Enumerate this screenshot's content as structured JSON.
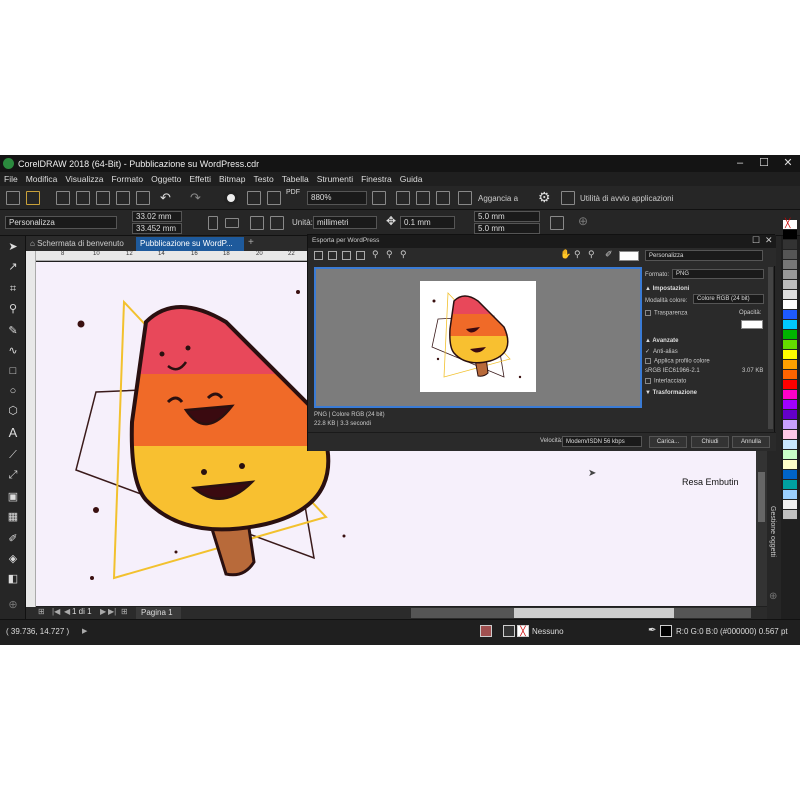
{
  "window": {
    "title": "CorelDRAW 2018 (64-Bit) - Pubblicazione su WordPress.cdr"
  },
  "menu": [
    "File",
    "Modifica",
    "Visualizza",
    "Formato",
    "Oggetto",
    "Effetti",
    "Bitmap",
    "Testo",
    "Tabella",
    "Strumenti",
    "Finestra",
    "Guida"
  ],
  "toolbar": {
    "zoom": "880%",
    "snap_label": "Aggancia a",
    "launch_label": "Utilità di avvio applicazioni"
  },
  "propbar": {
    "preset": "Personalizza",
    "width": "33.02 mm",
    "height": "33.452 mm",
    "unit_label": "Unità:",
    "unit_value": "millimetri",
    "nudge": "0.1 mm",
    "dup_x": "5.0 mm",
    "dup_y": "5.0 mm"
  },
  "tabs": {
    "welcome": "Schermata di benvenuto",
    "doc": "Pubblicazione su WordP..."
  },
  "ruler": [
    "8",
    "10",
    "12",
    "14",
    "16",
    "18",
    "20",
    "22",
    "24",
    "26",
    "28",
    "30",
    "32",
    "34",
    "36",
    "38",
    "40"
  ],
  "canvas": {
    "caption": "Resa Embutin"
  },
  "pagebar": {
    "page_of": "1 di 1",
    "page_tab": "Pagina 1"
  },
  "status": {
    "coords": "( 39.736, 14.727 )",
    "fill": "Nessuno",
    "outline": "R:0 G:0 B:0 (#000000)  0.567 pt"
  },
  "docker": {
    "label": "Gestione oggetti"
  },
  "dialog": {
    "title": "Esporta per WordPress",
    "preset": "Personalizza",
    "format_label": "Formato:",
    "format_value": "PNG",
    "settings_header": "Impostazioni",
    "color_mode_label": "Modalità colore:",
    "color_mode_value": "Colore RGB (24 bit)",
    "transparency": "Trasparenza",
    "opacity": "Opacità:",
    "advanced_header": "Avanzate",
    "antialias": "Anti-alias",
    "apply_profile": "Applica profilo colore",
    "profile": "sRGB IEC61966-2.1",
    "size_kb": "3.07 KB",
    "interlaced": "Interlacciato",
    "transform_header": "Trasformazione",
    "info_line1": "PNG  |  Colore RGB (24 bit)",
    "info_line2": "22.8 KB  |  3.3 secondi",
    "speed_label": "Velocità:",
    "speed_value": "Modem/ISDN 56 kbps",
    "btn_load": "Carica...",
    "btn_close": "Chiudi",
    "btn_cancel": "Annulla"
  },
  "colors": {
    "accent": "#3a7bd5",
    "candy_top": "#e8485a",
    "candy_mid": "#f06a28",
    "candy_bot": "#f8c030",
    "stick": "#b86a3a",
    "triangle": "#f2c12e"
  }
}
